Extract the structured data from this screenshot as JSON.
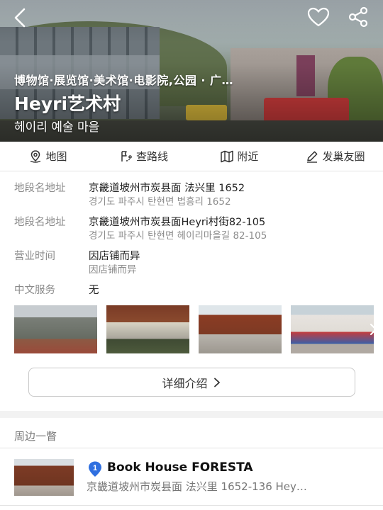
{
  "hero": {
    "categories": "博物馆·展览馆·美术馆·电影院,公园 · 广…",
    "title": "Heyri艺术村",
    "subtitle": "헤이리 예술 마을"
  },
  "top_icons": {
    "back": "back-arrow-icon",
    "favorite": "heart-icon",
    "share": "share-icon"
  },
  "actions": [
    {
      "label": "地图",
      "icon": "map-pin-icon"
    },
    {
      "label": "查路线",
      "icon": "route-icon"
    },
    {
      "label": "附近",
      "icon": "map-icon"
    },
    {
      "label": "发巢友圈",
      "icon": "pencil-icon"
    }
  ],
  "info": [
    {
      "label": "地段名地址",
      "value": "京畿道坡州市炭县面 法兴里 1652",
      "sub": "경기도 파주시 탄현면 법흥리 1652"
    },
    {
      "label": "地段名地址",
      "value": "京畿道坡州市炭县面Heyri村街82-105",
      "sub": "경기도 파주시 탄현면 헤이리마을길 82-105"
    },
    {
      "label": "营业时间",
      "value": "因店铺而异",
      "sub": "因店铺而异"
    },
    {
      "label": "中文服务",
      "value": "无",
      "sub": ""
    }
  ],
  "detail_button": "详细介绍",
  "nearby": {
    "title": "周边一瞥",
    "items": [
      {
        "rank": "1",
        "name": "Book House FORESTA",
        "address": "京畿道坡州市炭县面 法兴里 1652-136 Hey…"
      }
    ]
  },
  "colors": {
    "accent_blue": "#2f6fe0",
    "label_gray": "#8a8a8a",
    "divider": "#f2f2f2"
  }
}
